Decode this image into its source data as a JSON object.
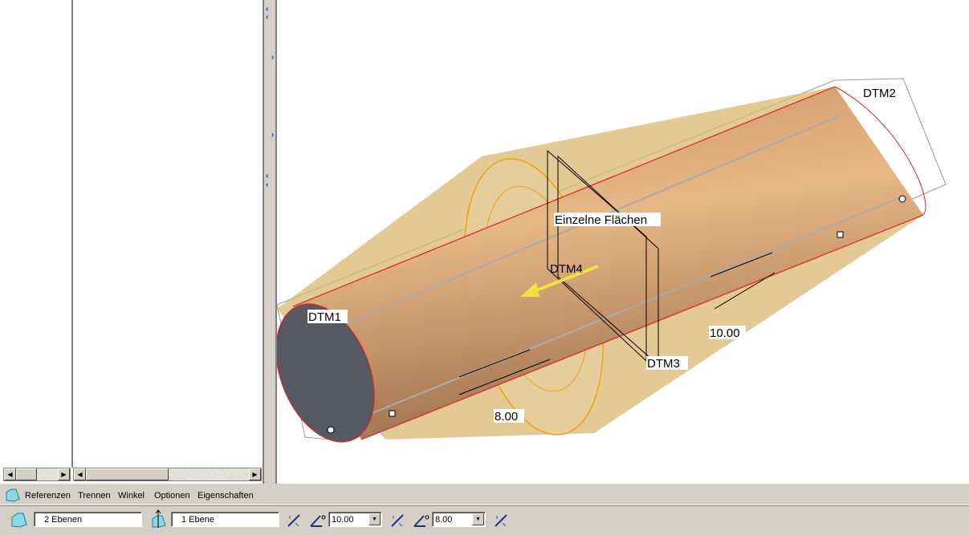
{
  "tabs": [
    "Referenzen",
    "Trennen",
    "Winkel",
    "Optionen",
    "Eigenschaften"
  ],
  "controls": {
    "ref1": "2 Ebenen",
    "ref2": "1 Ebene",
    "angle1": "10.00",
    "angle2": "8.00"
  },
  "model": {
    "labels": {
      "dtm1": "DTM1",
      "dtm2": "DTM2",
      "dtm3": "DTM3",
      "dtm4": "DTM4",
      "surface": "Einzelne Flächen",
      "dim1": "10.00",
      "dim2": "8.00"
    }
  },
  "colors": {
    "cylinder": "#e0a070",
    "cone": "#d9b870",
    "edge": "#e02020"
  }
}
